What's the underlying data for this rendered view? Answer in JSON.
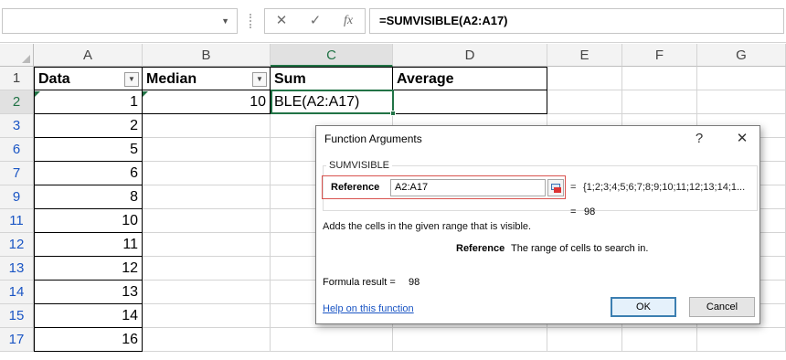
{
  "formula_bar": {
    "name_box": "",
    "cancel_icon": "✕",
    "enter_icon": "✓",
    "fx_label": "fx",
    "formula": "=SUMVISIBLE(A2:A17)"
  },
  "columns": [
    "A",
    "B",
    "C",
    "D",
    "E",
    "F",
    "G"
  ],
  "rows": [
    {
      "row": "1",
      "a": "Data",
      "b": "Median",
      "c": "Sum",
      "d": "Average"
    },
    {
      "row": "2",
      "a": "1",
      "b": "10",
      "c": "BLE(A2:A17)",
      "d": ""
    },
    {
      "row": "3",
      "a": "2",
      "b": "",
      "c": "",
      "d": ""
    },
    {
      "row": "6",
      "a": "5",
      "b": "",
      "c": "",
      "d": ""
    },
    {
      "row": "7",
      "a": "6",
      "b": "",
      "c": "",
      "d": ""
    },
    {
      "row": "9",
      "a": "8",
      "b": "",
      "c": "",
      "d": ""
    },
    {
      "row": "11",
      "a": "10",
      "b": "",
      "c": "",
      "d": ""
    },
    {
      "row": "12",
      "a": "11",
      "b": "",
      "c": "",
      "d": ""
    },
    {
      "row": "13",
      "a": "12",
      "b": "",
      "c": "",
      "d": ""
    },
    {
      "row": "14",
      "a": "13",
      "b": "",
      "c": "",
      "d": ""
    },
    {
      "row": "15",
      "a": "14",
      "b": "",
      "c": "",
      "d": ""
    },
    {
      "row": "17",
      "a": "16",
      "b": "",
      "c": "",
      "d": ""
    }
  ],
  "dialog": {
    "title": "Function Arguments",
    "help": "?",
    "close": "✕",
    "function_name": "SUMVISIBLE",
    "arg_label": "Reference",
    "arg_value": "A2:A17",
    "arg_eq": "=",
    "arg_result": "{1;2;3;4;5;6;7;8;9;10;11;12;13;14;1...",
    "result_eq": "=",
    "result_value": "98",
    "description": "Adds the cells in the given range that is visible.",
    "arg_desc_label": "Reference",
    "arg_desc_text": "The range of cells to search in.",
    "formula_result_label": "Formula result =",
    "formula_result_value": "98",
    "help_link": "Help on this function",
    "ok": "OK",
    "cancel": "Cancel"
  }
}
